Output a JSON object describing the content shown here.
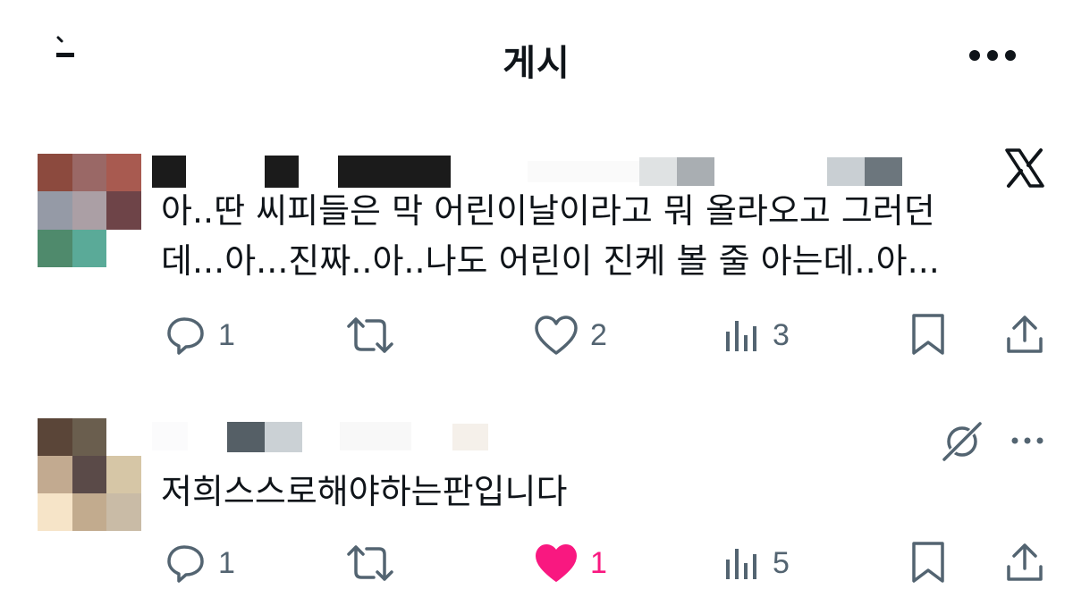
{
  "header": {
    "title": "게시",
    "back_icon": "back-arrow-icon",
    "more_icon": "more-horizontal-icon"
  },
  "posts": [
    {
      "text": "아..딴 씨피들은 막 어린이날이라고 뭐 올라오고 그러던\n데...아...진짜..아..나도 어린이 진케 볼 줄 아는데..아...",
      "avatar_blurred": true,
      "name_blurred": true,
      "badge_icon": "x-logo-icon",
      "stats": {
        "replies": "1",
        "retweets": "",
        "likes": "2",
        "views": "3"
      },
      "liked": false
    },
    {
      "text": "저희스스로해야하는판입니다",
      "avatar_blurred": true,
      "name_blurred": true,
      "badge_icon": "grok-icon",
      "stats": {
        "replies": "1",
        "retweets": "",
        "likes": "1",
        "views": "5"
      },
      "liked": true
    }
  ],
  "colors": {
    "text": "#0f1419",
    "muted": "#536471",
    "like_active": "#f91880"
  }
}
